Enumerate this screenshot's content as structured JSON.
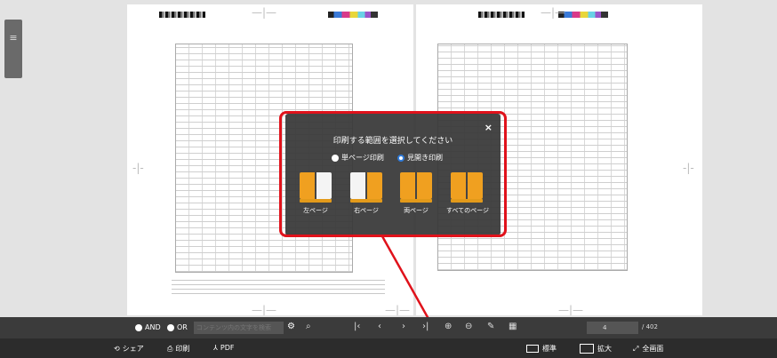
{
  "dialog": {
    "title": "印刷する範囲を選択してください",
    "close": "×",
    "radio_single": "単ページ印刷",
    "radio_spread": "見開き印刷",
    "options": [
      "左ページ",
      "右ページ",
      "両ページ",
      "すべてのページ"
    ]
  },
  "search": {
    "and_label": "AND",
    "or_label": "OR",
    "placeholder": "コンテンツ内の文字を検索",
    "page_value": "4",
    "page_total": "/ 402"
  },
  "bottom": {
    "share": "シェア",
    "print": "印刷",
    "pdf": "PDF",
    "mode_normal": "標準",
    "mode_zoom": "拡大",
    "mode_fullscreen": "全画面"
  },
  "icons": {
    "search": "magnifier-icon",
    "first": "first-page-icon",
    "prev": "prev-page-icon",
    "next": "next-page-icon",
    "last": "last-page-icon",
    "zoom_in": "zoom-in-icon",
    "zoom_out": "zoom-out-icon",
    "pen": "pen-icon",
    "thumbnails": "thumbnails-icon"
  },
  "colors": {
    "accent_orange": "#f0a020",
    "highlight_red": "#e0121b",
    "radio_blue": "#2f7ad8"
  }
}
